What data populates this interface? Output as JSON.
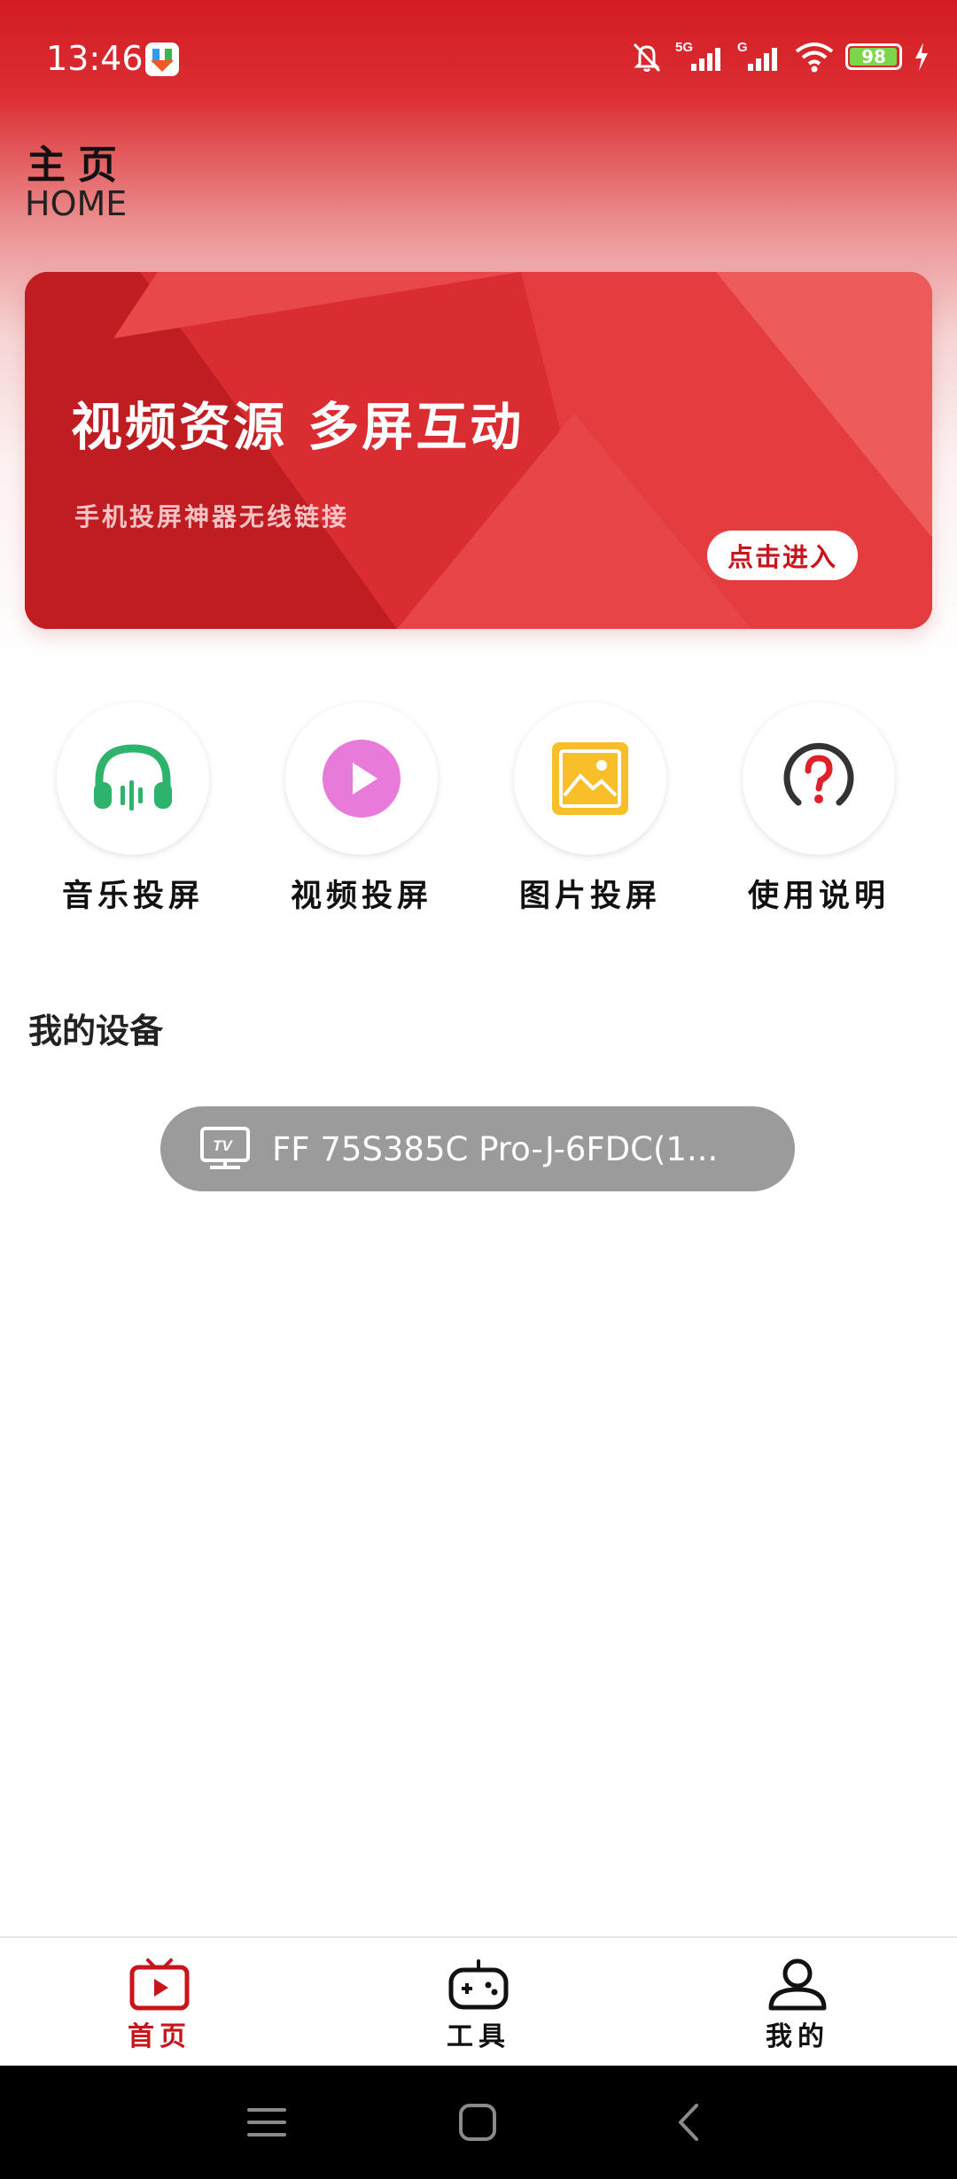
{
  "status_bar": {
    "time": "13:46",
    "battery": "98",
    "battery_level": 0.98,
    "icons": [
      "app-download-icon",
      "bell-off-icon",
      "signal-5g-icon",
      "signal-g-icon",
      "wifi-icon",
      "battery-icon",
      "charging-icon"
    ]
  },
  "header": {
    "title": "主页",
    "subtitle": "HOME"
  },
  "banner": {
    "title": "视频资源 多屏互动",
    "subtitle": "手机投屏神器无线链接",
    "button_label": "点击进入"
  },
  "quick_actions": [
    {
      "label": "音乐投屏",
      "icon": "headphones-icon",
      "color": "#2db36b"
    },
    {
      "label": "视频投屏",
      "icon": "play-icon",
      "color": "#e87bd9"
    },
    {
      "label": "图片投屏",
      "icon": "image-icon",
      "color": "#f9bf2a"
    },
    {
      "label": "使用说明",
      "icon": "help-icon",
      "color": "#e0202a"
    }
  ],
  "devices": {
    "title": "我的设备",
    "items": [
      {
        "name": "FF 75S385C Pro-J-6FDC(1...",
        "icon": "tv-icon"
      }
    ]
  },
  "bottom_nav": {
    "items": [
      {
        "label": "首页",
        "icon": "tv-home-icon",
        "active": true
      },
      {
        "label": "工具",
        "icon": "gamepad-icon",
        "active": false
      },
      {
        "label": "我的",
        "icon": "user-icon",
        "active": false
      }
    ],
    "active_color": "#c8141b"
  },
  "system_nav": {
    "icons": [
      "menu-icon",
      "home-square-icon",
      "back-icon"
    ]
  }
}
